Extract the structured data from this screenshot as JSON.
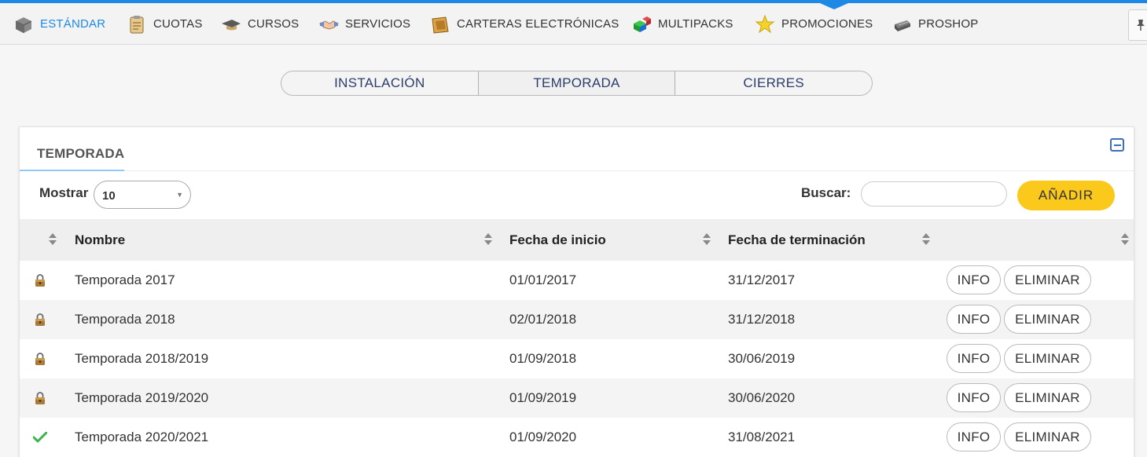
{
  "nav": {
    "items": [
      {
        "label": "ESTÁNDAR",
        "icon": "box-icon",
        "active": true
      },
      {
        "label": "CUOTAS",
        "icon": "clipboard-icon",
        "active": false
      },
      {
        "label": "CURSOS",
        "icon": "graduation-cap-icon",
        "active": false
      },
      {
        "label": "SERVICIOS",
        "icon": "handshake-icon",
        "active": false
      },
      {
        "label": "CARTERAS ELECTRÓNICAS",
        "icon": "wallet-icon",
        "active": false
      },
      {
        "label": "MULTIPACKS",
        "icon": "cubes-icon",
        "active": false
      },
      {
        "label": "PROMOCIONES",
        "icon": "star-icon",
        "active": false
      },
      {
        "label": "PROSHOP",
        "icon": "cash-register-icon",
        "active": false
      }
    ]
  },
  "tabs": [
    {
      "label": "INSTALACIÓN",
      "active": false
    },
    {
      "label": "TEMPORADA",
      "active": true
    },
    {
      "label": "CIERRES",
      "active": false
    }
  ],
  "panel": {
    "title": "TEMPORADA",
    "show_label": "Mostrar",
    "show_value": "10",
    "search_label": "Buscar:",
    "search_value": "",
    "add_label": "AÑADIR"
  },
  "table": {
    "columns": [
      "Nombre",
      "Fecha de inicio",
      "Fecha de terminación"
    ],
    "rows": [
      {
        "status": "lock",
        "name": "Temporada 2017",
        "start": "01/01/2017",
        "end": "31/12/2017"
      },
      {
        "status": "lock",
        "name": "Temporada 2018",
        "start": "02/01/2018",
        "end": "31/12/2018"
      },
      {
        "status": "lock",
        "name": "Temporada 2018/2019",
        "start": "01/09/2018",
        "end": "30/06/2019"
      },
      {
        "status": "lock",
        "name": "Temporada 2019/2020",
        "start": "01/09/2019",
        "end": "30/06/2020"
      },
      {
        "status": "check",
        "name": "Temporada 2020/2021",
        "start": "01/09/2020",
        "end": "31/08/2021"
      }
    ],
    "info_label": "INFO",
    "delete_label": "ELIMINAR"
  },
  "colors": {
    "accent": "#1e88e5",
    "add_button": "#fbc91b",
    "tab_text": "#2c3e6a"
  }
}
